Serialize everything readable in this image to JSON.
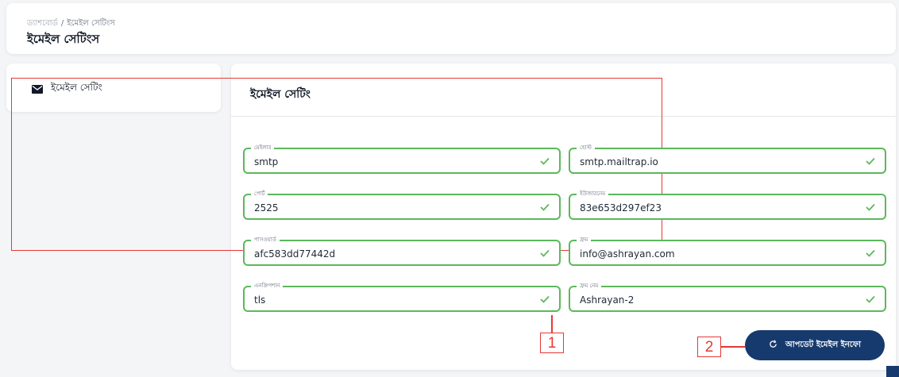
{
  "breadcrumb": {
    "home": "ড্যাশবোর্ড",
    "separator": "/",
    "current": "ইমেইল সেটিংস"
  },
  "page_title": "ইমেইল সেটিংস",
  "sidebar": {
    "items": [
      {
        "label": "ইমেইল সেটিং",
        "icon": "envelope-icon"
      }
    ]
  },
  "card": {
    "title": "ইমেইল সেটিং"
  },
  "fields": {
    "mailer": {
      "label": "মেইলার",
      "value": "smtp"
    },
    "host": {
      "label": "হোস্ট",
      "value": "smtp.mailtrap.io"
    },
    "port": {
      "label": "পোর্ট",
      "value": "2525"
    },
    "username": {
      "label": "ইউজারনেম",
      "value": "83e653d297ef23"
    },
    "password": {
      "label": "পাসওয়ার্ড",
      "value": "afc583dd77442d"
    },
    "from": {
      "label": "ফ্রম",
      "value": "info@ashrayan.com"
    },
    "encryption": {
      "label": "এনক্রিপশান",
      "value": "tls"
    },
    "from_name": {
      "label": "ফ্রম নেম",
      "value": "Ashrayan-2"
    }
  },
  "annotations": {
    "callout_1": "1",
    "callout_2": "2"
  },
  "actions": {
    "update_label": "আপডেট ইমেইল ইনফো",
    "update_icon": "refresh-icon"
  },
  "colors": {
    "valid": "#5cb85c",
    "primary": "#173a6e",
    "annotation": "#e53935"
  }
}
